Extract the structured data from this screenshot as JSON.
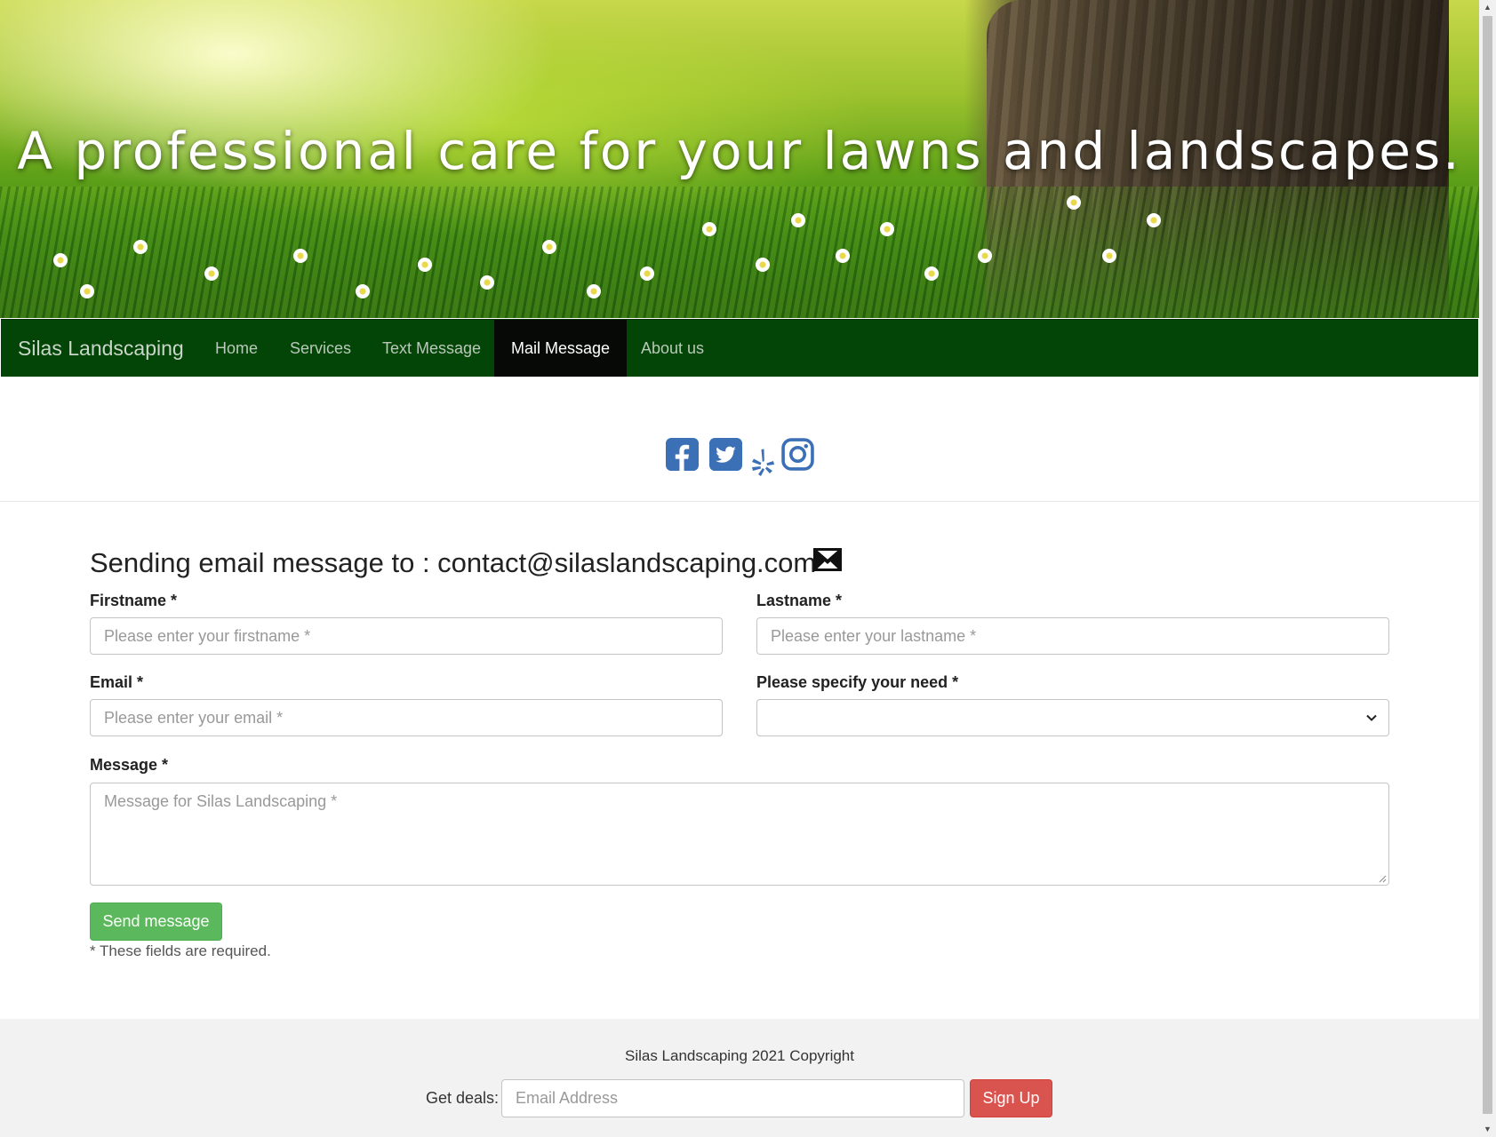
{
  "hero": {
    "title": "A professional care for your lawns and landscapes."
  },
  "nav": {
    "brand": "Silas Landscaping",
    "items": [
      {
        "label": "Home"
      },
      {
        "label": "Services"
      },
      {
        "label": "Text Message"
      },
      {
        "label": "Mail Message",
        "active": true
      },
      {
        "label": "About us"
      }
    ]
  },
  "social": {
    "icons": [
      "facebook-icon",
      "twitter-icon",
      "yelp-icon",
      "instagram-icon"
    ],
    "color": "#3b6fb6"
  },
  "form": {
    "heading": "Sending email message to : contact@silaslandscaping.com",
    "firstname_label": "Firstname *",
    "firstname_placeholder": "Please enter your firstname *",
    "lastname_label": "Lastname *",
    "lastname_placeholder": "Please enter your lastname *",
    "email_label": "Email *",
    "email_placeholder": "Please enter your email *",
    "need_label": "Please specify your need *",
    "need_value": "",
    "message_label": "Message *",
    "message_placeholder": "Message for Silas Landscaping *",
    "send_label": "Send message",
    "required_note": "* These fields are required."
  },
  "footer": {
    "copyright": "Silas Landscaping 2021 Copyright",
    "deals_label": "Get deals:",
    "email_placeholder": "Email Address",
    "signup_label": "Sign Up"
  },
  "colors": {
    "navbar": "#034506",
    "active_nav": "#070907",
    "send_button": "#5cb85c",
    "signup_button": "#d9534f"
  }
}
